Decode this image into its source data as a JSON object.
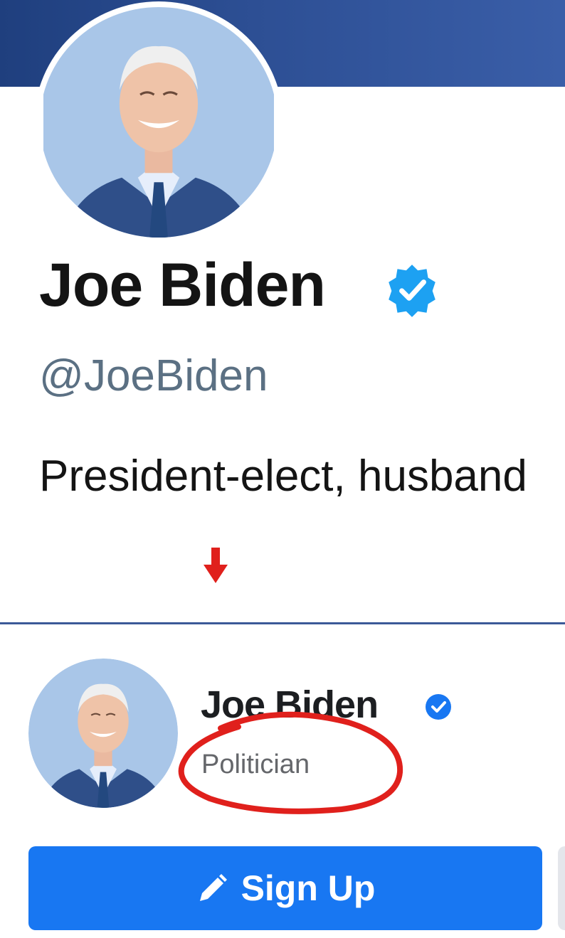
{
  "twitter": {
    "name": "Joe Biden",
    "handle": "@JoeBiden",
    "bio": "President-elect, husband",
    "verified_icon": "verified-badge-icon",
    "banner_color": "#2d4f94",
    "badge_color": "#1da1f2"
  },
  "annotation": {
    "arrow_icon": "down-arrow-icon",
    "arrow_color": "#e0201c",
    "circle_color": "#e0201c"
  },
  "facebook": {
    "name": "Joe Biden",
    "category": "Politician",
    "verified_icon": "verified-badge-icon",
    "signup_label": "Sign Up",
    "signup_icon": "pencil-icon",
    "button_color": "#1877f2"
  }
}
